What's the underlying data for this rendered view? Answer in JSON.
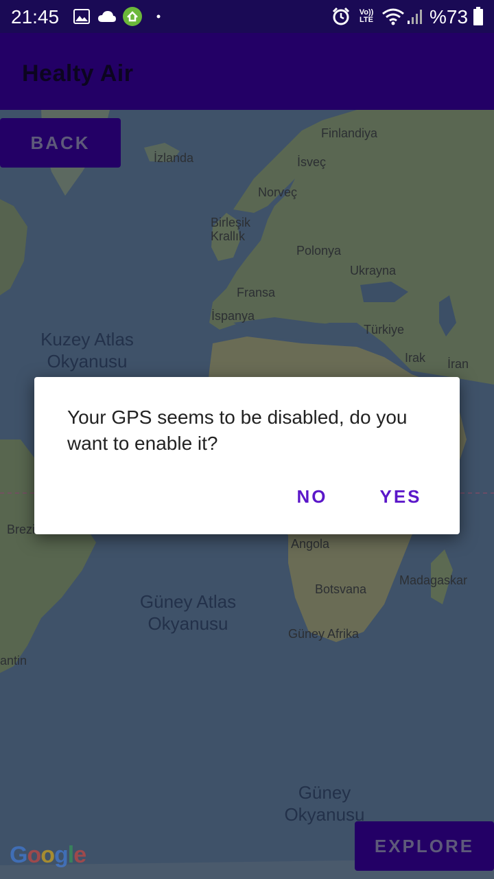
{
  "status_bar": {
    "time": "21:45",
    "battery": "%73",
    "icons": [
      "image-icon",
      "cloud-icon",
      "app-notification-icon",
      "dot-icon",
      "alarm-icon",
      "volte-icon",
      "wifi-icon",
      "signal-icon",
      "battery-icon"
    ],
    "volte_label": "Vo))\nLTE"
  },
  "app_bar": {
    "title": "Healty Air"
  },
  "map": {
    "labels": {
      "finlandiya": "Finlandiya",
      "izlanda": "İzlanda",
      "isvec": "İsveç",
      "norvec": "Norveç",
      "birlesik_krallik": "Birleşik\nKrallık",
      "polonya": "Polonya",
      "ukrayna": "Ukrayna",
      "fransa": "Fransa",
      "ispanya": "İspanya",
      "turkiye": "Türkiye",
      "irak": "Irak",
      "iran": "İran",
      "brezilya": "Brezi",
      "angola": "Angola",
      "madagaskar": "Madagaskar",
      "botsvana": "Botsvana",
      "guney_afrika": "Güney Afrika",
      "arjantin": "antin"
    },
    "oceans": {
      "kuzey_atlas": "Kuzey Atlas\nOkyanusu",
      "guney_atlas": "Güney Atlas\nOkyanusu",
      "guney_okyanusu": "Güney\nOkyanusu"
    },
    "logo": "Google"
  },
  "buttons": {
    "back": "BACK",
    "explore": "EXPLORE"
  },
  "dialog": {
    "message": "Your GPS seems to be disabled, do you want to enable it?",
    "no": "NO",
    "yes": "YES"
  },
  "colors": {
    "primary": "#230066",
    "accent": "#5b17c9",
    "status_bar": "#1a0a55"
  }
}
